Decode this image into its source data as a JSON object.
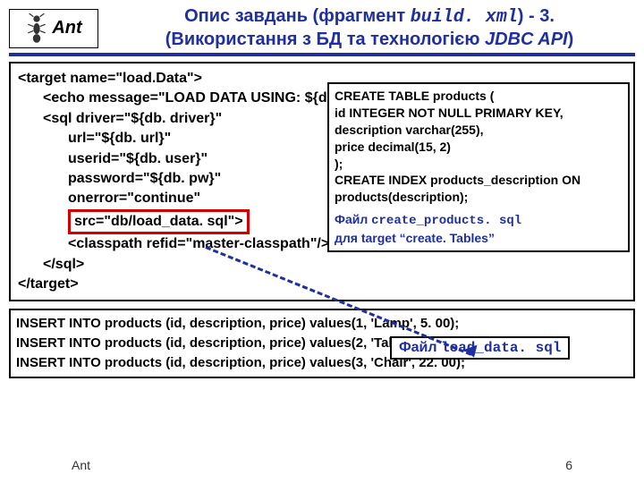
{
  "logo": {
    "text": "Ant"
  },
  "title": {
    "line1a": "Опис завдань (фрагмент ",
    "line1b": "build. xml",
    "line1c": ") - 3.",
    "line2a": "(Використання з БД та технологією ",
    "line2b": "JDBC API",
    "line2c": ")"
  },
  "code": {
    "l1": "<target name=\"load.Data\">",
    "l2": "<echo message=\"LOAD DATA USING: ${db. driver} ${db. url}\"/>",
    "l3": "<sql driver=\"${db. driver}\"",
    "l4": "url=\"${db. url}\"",
    "l5": "userid=\"${db. user}\"",
    "l6": "password=\"${db. pw}\"",
    "l7": "onerror=\"continue\"",
    "l8": "src=\"db/load_data. sql\">",
    "l9": "<classpath refid=\"master-classpath\"/>",
    "l10": "</sql>",
    "l11": "</target>"
  },
  "callout1": {
    "l1": "CREATE TABLE products (",
    "l2": "  id INTEGER NOT NULL PRIMARY KEY,",
    "l3": "  description varchar(255),",
    "l4": "  price decimal(15, 2)",
    "l5": ");",
    "l6": "CREATE INDEX products_description ON products(description);",
    "file_label": "Файл ",
    "file_name": "create_products. sql",
    "note": "для target “create. Tables”"
  },
  "sql": {
    "l1": "INSERT INTO products (id, description, price) values(1, 'Lamp', 5. 00);",
    "l2": "INSERT INTO products (id, description, price) values(2, 'Table', 75. 00);",
    "l3": "INSERT INTO products (id, description, price) values(3, 'Chair', 22. 00);"
  },
  "callout2": {
    "file_label": "Файл ",
    "file_name": "load_data. sql"
  },
  "footer": {
    "left": "Ant",
    "right": "6"
  }
}
